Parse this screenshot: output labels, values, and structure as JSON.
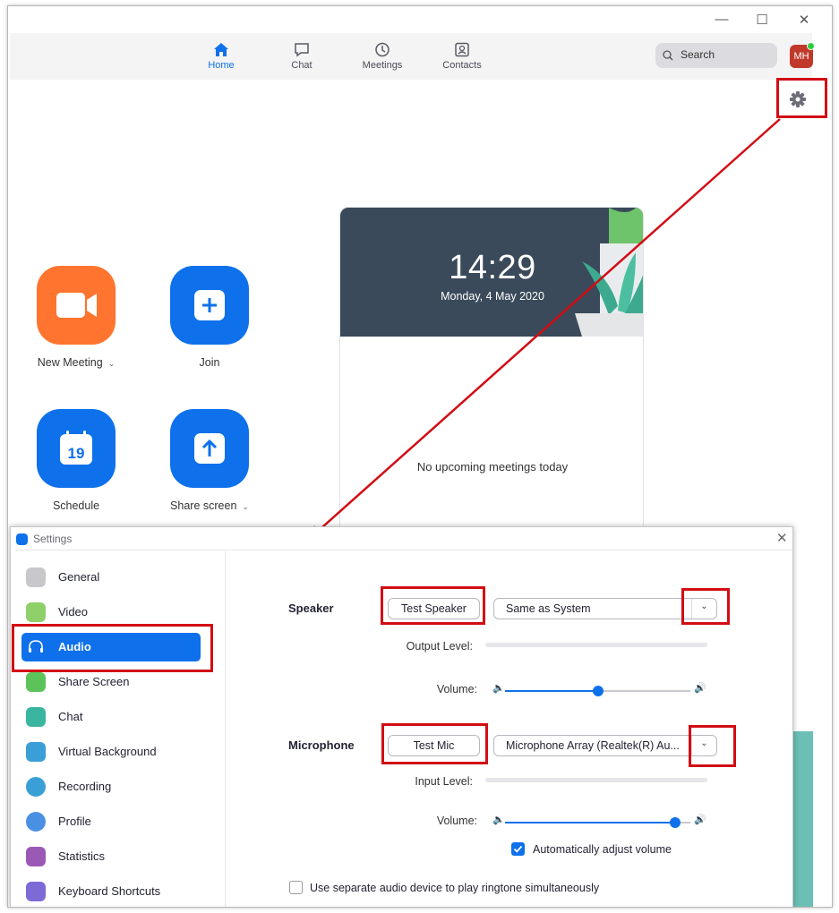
{
  "window": {
    "controls": [
      "—",
      "☐",
      "✕"
    ]
  },
  "nav": {
    "tabs": [
      {
        "label": "Home",
        "icon": "home-icon"
      },
      {
        "label": "Chat",
        "icon": "chat-icon"
      },
      {
        "label": "Meetings",
        "icon": "clock-icon"
      },
      {
        "label": "Contacts",
        "icon": "contacts-icon"
      }
    ],
    "search_label": "Search",
    "avatar_initials": "MH",
    "accent": "#0e71eb"
  },
  "home": {
    "tiles": [
      {
        "label": "New Meeting",
        "icon": "video-camera-icon",
        "color": "#ff742e"
      },
      {
        "label": "Join",
        "icon": "plus-icon",
        "color": "#0e71eb"
      },
      {
        "label": "Schedule",
        "icon": "calendar-icon",
        "calendar_day": "19",
        "color": "#0e71eb"
      },
      {
        "label": "Share screen",
        "icon": "share-up-arrow-icon",
        "color": "#0e71eb"
      }
    ],
    "card": {
      "time": "14:29",
      "date": "Monday, 4 May 2020",
      "empty_text": "No upcoming meetings today"
    }
  },
  "settings": {
    "title": "Settings",
    "close": "✕",
    "sidebar": [
      {
        "label": "General",
        "icon": "gear-icon",
        "color": "#c8c8cc"
      },
      {
        "label": "Video",
        "icon": "video-icon",
        "color": "#8fd06a"
      },
      {
        "label": "Audio",
        "icon": "headphones-icon",
        "color": "#0e71eb"
      },
      {
        "label": "Share Screen",
        "icon": "share-screen-icon",
        "color": "#5cc35a"
      },
      {
        "label": "Chat",
        "icon": "chat-icon",
        "color": "#3ab5a0"
      },
      {
        "label": "Virtual Background",
        "icon": "person-icon",
        "color": "#3a9fd6"
      },
      {
        "label": "Recording",
        "icon": "record-icon",
        "color": "#3a9fd6"
      },
      {
        "label": "Profile",
        "icon": "profile-icon",
        "color": "#4a90e2"
      },
      {
        "label": "Statistics",
        "icon": "bar-chart-icon",
        "color": "#9b59b6"
      },
      {
        "label": "Keyboard Shortcuts",
        "icon": "keyboard-icon",
        "color": "#7d6ad6"
      }
    ],
    "active_item": "Audio",
    "speaker": {
      "label": "Speaker",
      "test_button": "Test Speaker",
      "device": "Same as System",
      "level_label": "Output Level:",
      "volume_label": "Volume:",
      "volume": 0.5
    },
    "microphone": {
      "label": "Microphone",
      "test_button": "Test Mic",
      "device": "Microphone Array (Realtek(R) Au...",
      "level_label": "Input Level:",
      "volume_label": "Volume:",
      "volume": 0.92,
      "auto_adjust_label": "Automatically adjust volume",
      "auto_adjust_checked": true
    },
    "ringtone": {
      "label": "Use separate audio device to play ringtone simultaneously",
      "checked": false
    }
  },
  "annotation_color": "#d10d14"
}
